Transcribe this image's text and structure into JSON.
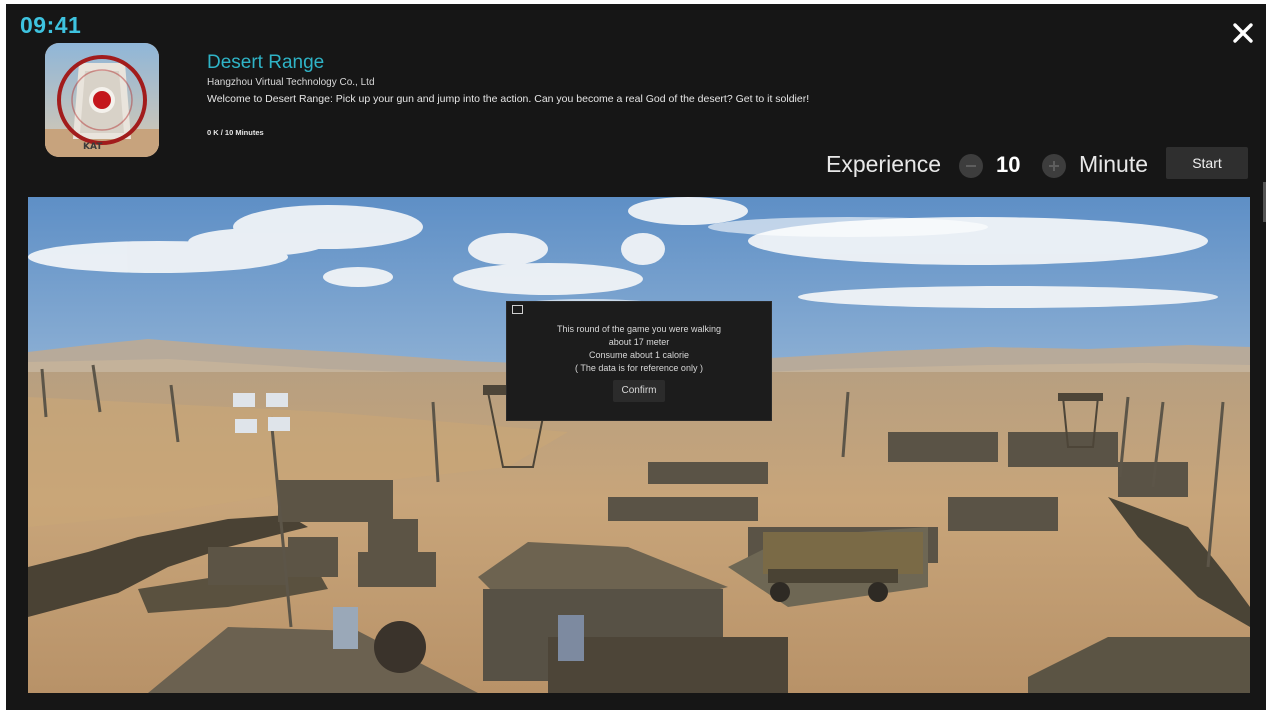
{
  "status_bar": {
    "time": "09:41"
  },
  "app": {
    "title": "Desert Range",
    "developer": "Hangzhou Virtual Technology Co., Ltd",
    "description": "Welcome to Desert Range: Pick up your gun and jump into the action. Can you become a real God of the desert? Get to it soldier!",
    "size_duration": "0 K / 10 Minutes",
    "icon": "target-icon",
    "icon_text": "KAT"
  },
  "controls": {
    "experience_label": "Experience",
    "minute_value": "10",
    "minute_label": "Minute",
    "start_label": "Start",
    "minus_icon": "minus-icon",
    "plus_icon": "plus-icon",
    "close_icon": "close-icon"
  },
  "dialog": {
    "lines": [
      "This round of the game you were walking",
      "about 17 meter",
      "Consume about 1 calorie",
      "( The data is for reference only )"
    ],
    "confirm_label": "Confirm"
  },
  "colors": {
    "accent": "#3ec3df",
    "title": "#2fb3c6",
    "background": "#161616"
  }
}
